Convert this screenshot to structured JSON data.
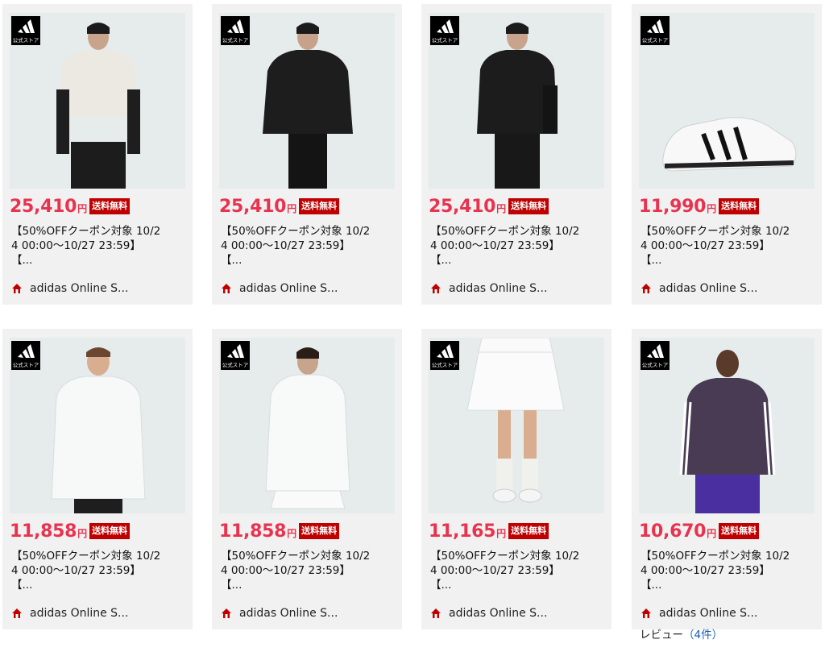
{
  "badge_text": "公式ストア",
  "currency": "円",
  "shipping_label": "送料無料",
  "products": [
    {
      "price": "25,410",
      "title_line1": "【50%OFFクーポン対象 10/2",
      "title_line2": "4 00:00〜10/27 23:59】",
      "title_line3": "【...",
      "shop": "adidas Online S..."
    },
    {
      "price": "25,410",
      "title_line1": "【50%OFFクーポン対象 10/2",
      "title_line2": "4 00:00〜10/27 23:59】",
      "title_line3": "【...",
      "shop": "adidas Online S..."
    },
    {
      "price": "25,410",
      "title_line1": "【50%OFFクーポン対象 10/2",
      "title_line2": "4 00:00〜10/27 23:59】",
      "title_line3": "【...",
      "shop": "adidas Online S..."
    },
    {
      "price": "11,990",
      "title_line1": "【50%OFFクーポン対象 10/2",
      "title_line2": "4 00:00〜10/27 23:59】",
      "title_line3": "【...",
      "shop": "adidas Online S..."
    },
    {
      "price": "11,858",
      "title_line1": "【50%OFFクーポン対象 10/2",
      "title_line2": "4 00:00〜10/27 23:59】",
      "title_line3": "【...",
      "shop": "adidas Online S..."
    },
    {
      "price": "11,858",
      "title_line1": "【50%OFFクーポン対象 10/2",
      "title_line2": "4 00:00〜10/27 23:59】",
      "title_line3": "【...",
      "shop": "adidas Online S..."
    },
    {
      "price": "11,165",
      "title_line1": "【50%OFFクーポン対象 10/2",
      "title_line2": "4 00:00〜10/27 23:59】",
      "title_line3": "【...",
      "shop": "adidas Online S..."
    },
    {
      "price": "10,670",
      "title_line1": "【50%OFFクーポン対象 10/2",
      "title_line2": "4 00:00〜10/27 23:59】",
      "title_line3": "【...",
      "shop": "adidas Online S..."
    }
  ],
  "review": {
    "label": "レビュー",
    "count": "（4件）"
  },
  "colors": {
    "price": "#e8334f",
    "shipping_bg": "#bf0000",
    "shop_icon": "#bf0000",
    "card_bg": "#f1f1f1",
    "review_link": "#1a5fb4"
  },
  "icons": {
    "badge": "adidas-logo-icon",
    "shop": "shop-house-icon"
  }
}
